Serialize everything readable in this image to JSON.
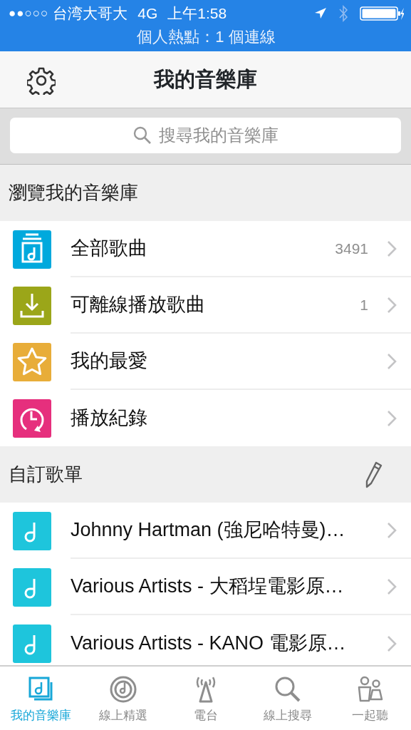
{
  "status_bar": {
    "signal": "●●○○○",
    "carrier": "台湾大哥大",
    "network": "4G",
    "time": "上午1:58",
    "hotspot": "個人熱點：1 個連線"
  },
  "nav": {
    "title": "我的音樂庫"
  },
  "search": {
    "placeholder": "搜尋我的音樂庫"
  },
  "browse": {
    "header": "瀏覽我的音樂庫",
    "items": [
      {
        "kind": "songs",
        "label": "全部歌曲",
        "count": "3491",
        "color": "#00a9dd"
      },
      {
        "kind": "offline",
        "label": "可離線播放歌曲",
        "count": "1",
        "color": "#9ba619"
      },
      {
        "kind": "favorite",
        "label": "我的最愛",
        "color": "#e8ad39"
      },
      {
        "kind": "history",
        "label": "播放紀錄",
        "color": "#e62f7d"
      }
    ]
  },
  "playlists": {
    "header": "自訂歌單",
    "items": [
      {
        "label": "Johnny Hartman (強尼哈特曼)…"
      },
      {
        "label": "Various Artists - 大稻埕電影原…"
      },
      {
        "label": "Various Artists - KANO 電影原…"
      }
    ]
  },
  "tab_bar": [
    {
      "kind": "library",
      "label": "我的音樂庫",
      "selected": true
    },
    {
      "kind": "picks",
      "label": "線上精選",
      "selected": false
    },
    {
      "kind": "radio",
      "label": "電台",
      "selected": false
    },
    {
      "kind": "search",
      "label": "線上搜尋",
      "selected": false
    },
    {
      "kind": "together",
      "label": "一起聽",
      "selected": false
    }
  ]
}
